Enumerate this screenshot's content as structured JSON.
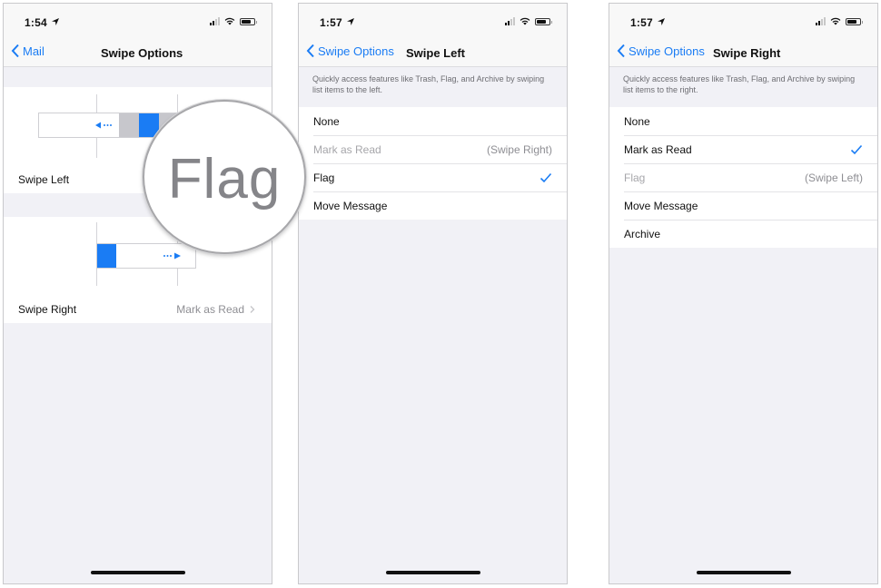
{
  "screens": [
    {
      "status": {
        "time": "1:54"
      },
      "nav": {
        "back": "Mail",
        "title": "Swipe Options"
      },
      "swipe_left": {
        "label": "Swipe Left",
        "value": "Flag"
      },
      "swipe_right": {
        "label": "Swipe Right",
        "value": "Mark as Read"
      },
      "magnifier_text": "Flag"
    },
    {
      "status": {
        "time": "1:57"
      },
      "nav": {
        "back": "Swipe Options",
        "title": "Swipe Left"
      },
      "description": "Quickly access features like Trash, Flag, and Archive by swiping list items to the left.",
      "options": [
        {
          "label": "None",
          "note": "",
          "checked": false,
          "disabled": false
        },
        {
          "label": "Mark as Read",
          "note": "(Swipe Right)",
          "checked": false,
          "disabled": true
        },
        {
          "label": "Flag",
          "note": "",
          "checked": true,
          "disabled": false
        },
        {
          "label": "Move Message",
          "note": "",
          "checked": false,
          "disabled": false
        }
      ]
    },
    {
      "status": {
        "time": "1:57"
      },
      "nav": {
        "back": "Swipe Options",
        "title": "Swipe Right"
      },
      "description": "Quickly access features like Trash, Flag, and Archive by swiping list items to the right.",
      "options": [
        {
          "label": "None",
          "note": "",
          "checked": false,
          "disabled": false
        },
        {
          "label": "Mark as Read",
          "note": "",
          "checked": true,
          "disabled": false
        },
        {
          "label": "Flag",
          "note": "(Swipe Left)",
          "checked": false,
          "disabled": true
        },
        {
          "label": "Move Message",
          "note": "",
          "checked": false,
          "disabled": false
        },
        {
          "label": "Archive",
          "note": "",
          "checked": false,
          "disabled": false
        }
      ]
    }
  ],
  "colors": {
    "accent": "#1a7cf4",
    "background": "#f1f1f6",
    "disabled_text": "#a6a6aa"
  },
  "icons": {
    "location": "location-arrow-icon",
    "signal": "cellular-signal-icon",
    "wifi": "wifi-icon",
    "battery": "battery-icon",
    "back": "chevron-left-icon",
    "disclosure": "chevron-right-icon",
    "check": "checkmark-icon"
  }
}
